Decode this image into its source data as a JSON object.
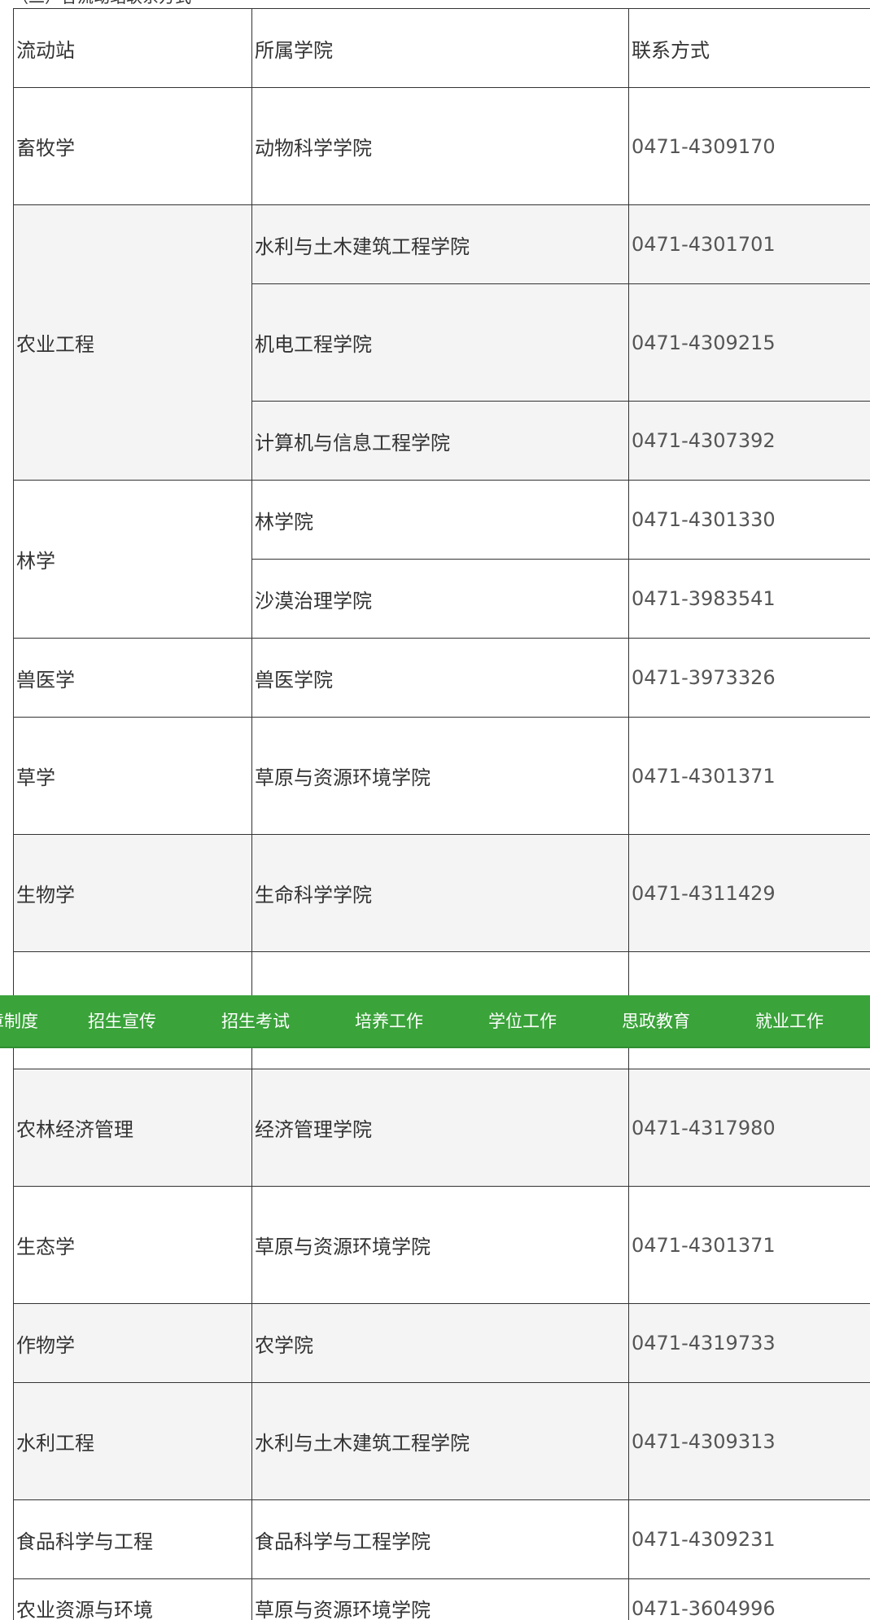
{
  "caption": "（二）各流动站联系方式",
  "table": {
    "headers": [
      "流动站",
      "所属学院",
      "联系方式"
    ],
    "rows": [
      {
        "station": "畜牧学",
        "college": "动物科学学院",
        "phone": "0471-4309170"
      },
      {
        "station": "农业工程",
        "college": "水利与土木建筑工程学院",
        "phone": "0471-4301701"
      },
      {
        "station": "",
        "college": "机电工程学院",
        "phone": "0471-4309215"
      },
      {
        "station": "",
        "college": "计算机与信息工程学院",
        "phone": "0471-4307392"
      },
      {
        "station": "林学",
        "college": "林学院",
        "phone": "0471-4301330"
      },
      {
        "station": "",
        "college": "沙漠治理学院",
        "phone": "0471-3983541"
      },
      {
        "station": "兽医学",
        "college": "兽医学院",
        "phone": "0471-3973326"
      },
      {
        "station": "草学",
        "college": "草原与资源环境学院",
        "phone": "0471-4301371"
      },
      {
        "station": "生物学",
        "college": "生命科学学院",
        "phone": "0471-4311429"
      },
      {
        "station": "",
        "college": "",
        "phone": ""
      },
      {
        "station": "农林经济管理",
        "college": "经济管理学院",
        "phone": "0471-4317980"
      },
      {
        "station": "生态学",
        "college": "草原与资源环境学院",
        "phone": "0471-4301371"
      },
      {
        "station": "作物学",
        "college": "农学院",
        "phone": "0471-4319733"
      },
      {
        "station": "水利工程",
        "college": "水利与土木建筑工程学院",
        "phone": "0471-4309313"
      },
      {
        "station": "食品科学与工程",
        "college": "食品科学与工程学院",
        "phone": "0471-4309231"
      },
      {
        "station": "农业资源与环境",
        "college": "草原与资源环境学院",
        "phone": "0471-3604996"
      }
    ]
  },
  "nav": {
    "items": [
      "规章制度",
      "招生宣传",
      "招生考试",
      "培养工作",
      "学位工作",
      "思政教育",
      "就业工作"
    ]
  },
  "colors": {
    "nav_background": "#3aa33a",
    "row_shade": "#f4f4f4",
    "border": "#333333"
  }
}
